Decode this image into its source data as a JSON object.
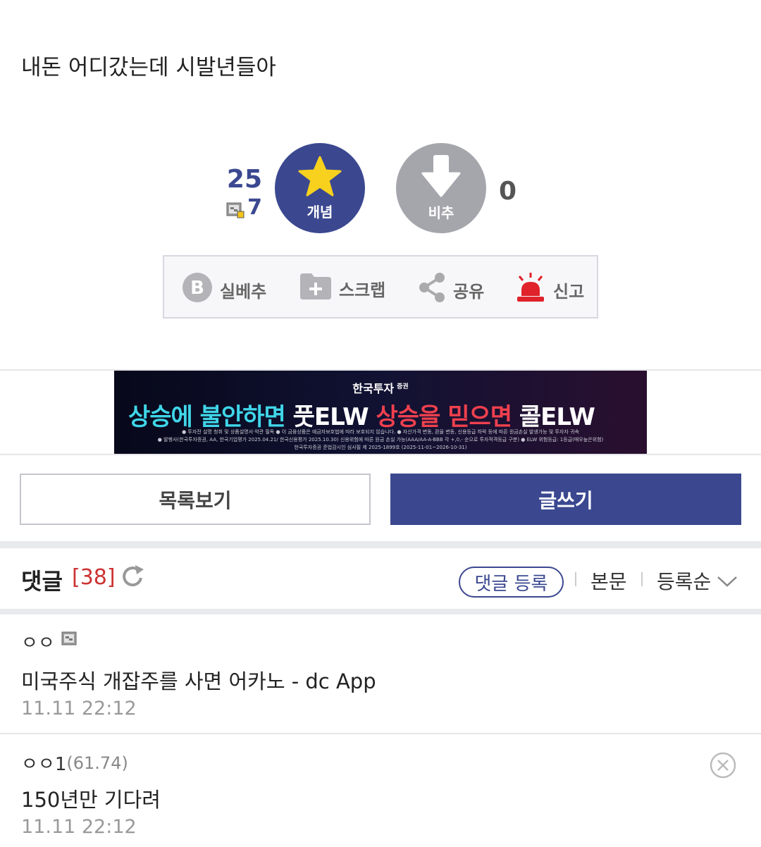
{
  "post": {
    "body": "내돈 어디갔는데 시발년들아"
  },
  "votes": {
    "up_count": "25",
    "fix_count": "7",
    "up_label": "개념",
    "down_label": "비추",
    "down_count": "0",
    "up_color": "#3b4890",
    "down_color": "#a5a5ac",
    "star_color": "#f7d11e"
  },
  "actions": [
    {
      "label": "실베추",
      "icon": "b-circle-icon"
    },
    {
      "label": "스크랩",
      "icon": "folder-plus-icon"
    },
    {
      "label": "공유",
      "icon": "share-icon"
    },
    {
      "label": "신고",
      "icon": "siren-icon"
    }
  ],
  "banner": {
    "brand": "한국투자",
    "brand_sub": "증권",
    "headline_1": "상승에 불안하면 ",
    "headline_2": "풋ELW ",
    "headline_3": "상승을 믿으면 ",
    "headline_4": "콜ELW",
    "fine_1": "● 투자전 설명 청취 및 상품설명서·약관 필독  ● 이 금융상품은 예금자보호법에 따라 보호되지 않습니다. ● 자산가격 변동, 환율 변동, 신용등급 하락 등에 따른 원금손실 발생가능 및 투자자 귀속",
    "fine_2": "● 발행사(한국투자증권, AA, 한국기업평가 2025.04.21/ 한국신용평가 2025.10.30) 신용위험에 따른 원금 손실 가능(AAA/AA-A-BBB 각 +,0,- 순으로 투자적격등급 구분) ● ELW 위험등급: 1등급(매우높은위험)",
    "fine_3": "한국투자증권 준법감시인 심사필 제 2025-1899호 (2025-11-01~2026-10-31)"
  },
  "buttons": {
    "list": "목록보기",
    "write": "글쓰기"
  },
  "comments_header": {
    "title": "댓글",
    "count": "[38]",
    "register": "댓글 등록",
    "main": "본문",
    "sort": "등록순"
  },
  "comments": [
    {
      "author": "ㅇㅇ",
      "ip": "",
      "text": "미국주식 개잡주를 사면 어카노 - dc App",
      "date": "11.11 22:12"
    },
    {
      "author": "ㅇㅇ1",
      "ip": "(61.74)",
      "text": "150년만 기다려",
      "date": "11.11 22:12"
    }
  ]
}
